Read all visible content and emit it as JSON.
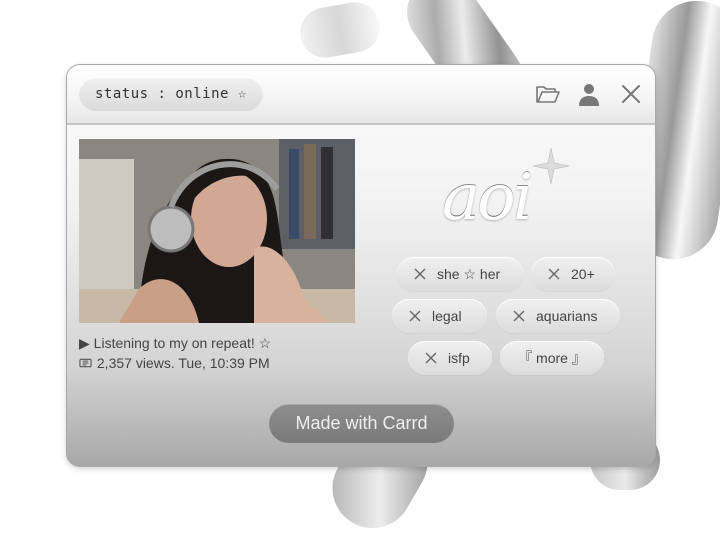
{
  "window": {
    "status": "status : online ☆"
  },
  "profile": {
    "name_logo": "aoi",
    "caption_listening": "Listening to my on repeat! ☆",
    "caption_views": "2,357 views. Tue, 10:39 PM",
    "play_glyph": "▶"
  },
  "tags": [
    {
      "label": "she ☆ her"
    },
    {
      "label": "20+"
    },
    {
      "label": "legal"
    },
    {
      "label": "aquarians"
    },
    {
      "label": "isfp"
    },
    {
      "label": "『 more 』"
    }
  ],
  "footer": {
    "made_with": "Made with Carrd"
  },
  "icons": {
    "folder": "folder-open-icon",
    "user": "user-icon",
    "close": "close-icon",
    "tag_remove": "x-icon",
    "views": "views-icon",
    "sparkle": "sparkle-icon"
  }
}
